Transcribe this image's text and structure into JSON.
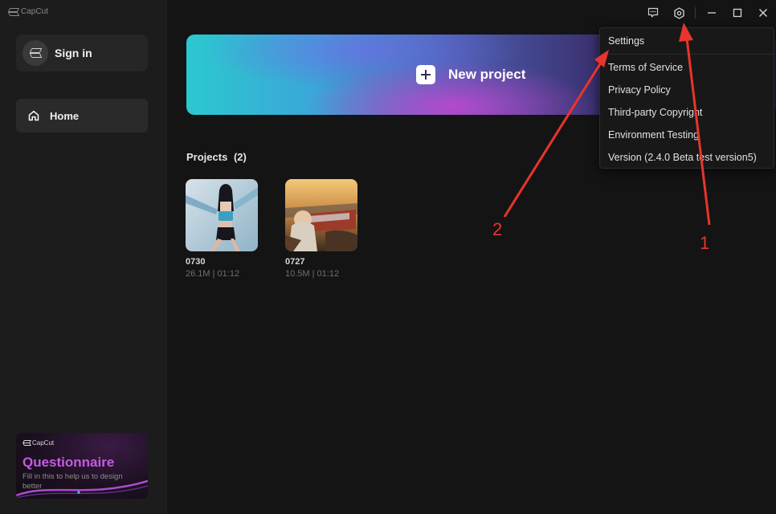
{
  "app": {
    "name": "CapCut"
  },
  "sidebar": {
    "sign_in": "Sign in",
    "home": "Home",
    "promo": {
      "brand": "CapCut",
      "title": "Questionnaire",
      "text": "Fill in this to help us to design better"
    }
  },
  "main": {
    "new_project": "New project",
    "projects_label": "Projects",
    "projects_count": "(2)",
    "projects": [
      {
        "name": "0730",
        "meta": "26.1M | 01:12"
      },
      {
        "name": "0727",
        "meta": "10.5M | 01:12"
      }
    ]
  },
  "titlebar": {
    "icons": [
      "feedback-icon",
      "settings-gear-icon",
      "minimize-icon",
      "maximize-icon",
      "close-icon"
    ]
  },
  "menu": {
    "items": [
      "Settings",
      "Terms of Service",
      "Privacy Policy",
      "Third-party Copyright",
      "Environment Testing",
      "Version (2.4.0 Beta test version5)"
    ]
  },
  "annotations": {
    "label_1": "1",
    "label_2": "2",
    "color": "#e8352d"
  },
  "colors": {
    "background": "#141414",
    "sidebar": "#1c1c1c",
    "promo_accent": "#c45ce0"
  }
}
